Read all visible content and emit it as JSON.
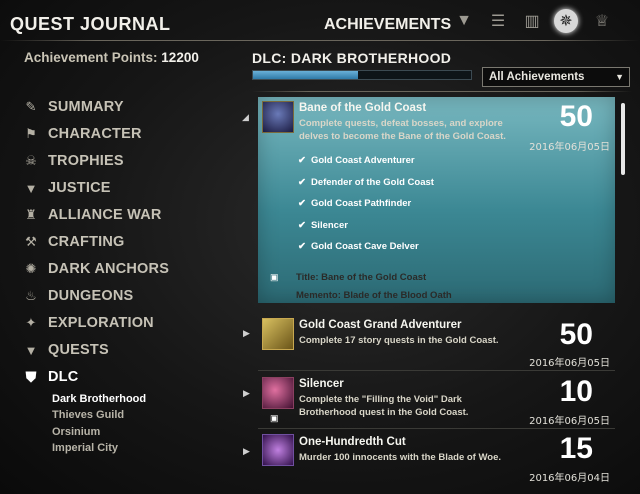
{
  "header": {
    "journal_title": "QUEST JOURNAL",
    "achievements_title": "ACHIEVEMENTS",
    "icons": [
      "justice-icon",
      "quest-scroll-icon",
      "books-icon",
      "achievements-emblem-icon",
      "trophy-icon"
    ],
    "active_icon": "achievements-emblem-icon"
  },
  "points": {
    "label": "Achievement Points:",
    "value": "12200"
  },
  "dlc_title": "DLC: DARK BROTHERHOOD",
  "progress_fraction": 0.48,
  "filter": {
    "selected": "All Achievements"
  },
  "categories": [
    {
      "label": "SUMMARY",
      "icon": "scroll-icon"
    },
    {
      "label": "CHARACTER",
      "icon": "banner-icon"
    },
    {
      "label": "TROPHIES",
      "icon": "skull-icon"
    },
    {
      "label": "JUSTICE",
      "icon": "justice-icon"
    },
    {
      "label": "ALLIANCE WAR",
      "icon": "tower-icon"
    },
    {
      "label": "CRAFTING",
      "icon": "hammer-icon"
    },
    {
      "label": "DARK ANCHORS",
      "icon": "anchor-swirl-icon"
    },
    {
      "label": "DUNGEONS",
      "icon": "flame-icon"
    },
    {
      "label": "EXPLORATION",
      "icon": "compass-star-icon"
    },
    {
      "label": "QUESTS",
      "icon": "quest-icon"
    },
    {
      "label": "DLC",
      "icon": "dlc-shield-icon"
    }
  ],
  "dlc_subcategories": [
    "Dark Brotherhood",
    "Thieves Guild",
    "Orsinium",
    "Imperial City"
  ],
  "achievements": [
    {
      "name": "Bane of the Gold Coast",
      "desc": "Complete quests, defeat bosses, and explore delves to become the Bane of the Gold Coast.",
      "points": "50",
      "date": "2016年06月05日",
      "criteria": [
        "Gold Coast Adventurer",
        "Defender of the Gold Coast",
        "Gold Coast Pathfinder",
        "Silencer",
        "Gold Coast Cave Delver"
      ],
      "rewards": [
        "Title: Bane of the Gold Coast",
        "Memento: Blade of the Blood Oath"
      ]
    },
    {
      "name": "Gold Coast Grand Adventurer",
      "desc": "Complete 17 story quests in the Gold Coast.",
      "points": "50",
      "date": "2016年06月05日"
    },
    {
      "name": "Silencer",
      "desc": "Complete the \"Filling the Void\" Dark Brotherhood quest in the Gold Coast.",
      "points": "10",
      "date": "2016年06月05日"
    },
    {
      "name": "One-Hundredth Cut",
      "desc": "Murder 100 innocents with the Blade of Woe.",
      "points": "15",
      "date": "2016年06月04日"
    }
  ],
  "colors": {
    "expanded_bg": "#4c98a2",
    "progress_fill": "#4a96c4"
  }
}
